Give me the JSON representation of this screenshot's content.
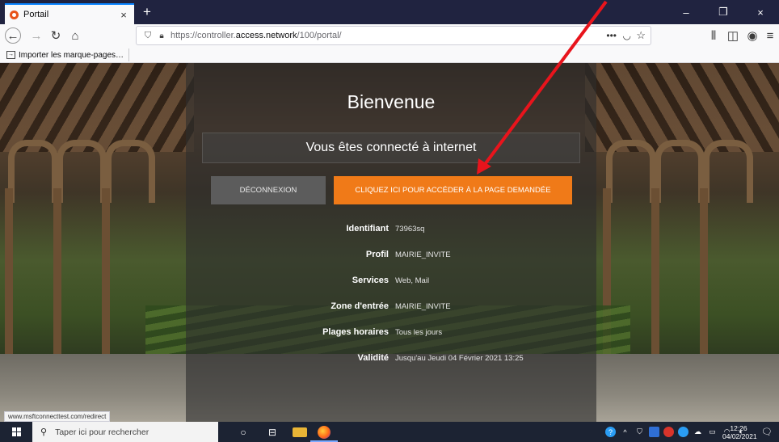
{
  "browser": {
    "tab_title": "Portail",
    "tab_close": "×",
    "new_tab": "+",
    "window_controls": {
      "minimize": "–",
      "maximize": "❐",
      "close": "×"
    },
    "url_prefix": "https://controller.",
    "url_host": "access.network",
    "url_path": "/100/portal/",
    "url_more": "•••",
    "bookmark_import": "Importer les marque-pages…",
    "status_link": "www.msftconnecttest.com/redirect"
  },
  "portal": {
    "title": "Bienvenue",
    "status": "Vous êtes connecté à internet",
    "logout_button": "Déconnexion",
    "continue_button": "CLIQUEZ ICI POUR ACCÉDER À LA PAGE DEMANDÉE",
    "info": [
      {
        "label": "Identifiant",
        "value": "73963sq"
      },
      {
        "label": "Profil",
        "value": "MAIRIE_INVITE"
      },
      {
        "label": "Services",
        "value": "Web, Mail"
      },
      {
        "label": "Zone d'entrée",
        "value": "MAIRIE_INVITE"
      },
      {
        "label": "Plages horaires",
        "value": "Tous les jours"
      },
      {
        "label": "Validité",
        "value": "Jusqu'au Jeudi 04 Février 2021 13:25"
      }
    ]
  },
  "taskbar": {
    "search_placeholder": "Taper ici pour rechercher",
    "time": "12:26",
    "date": "04/02/2021"
  },
  "colors": {
    "accent_orange": "#f07a18",
    "annotation_arrow": "#e8141c",
    "tab_highlight": "#0a84ff"
  }
}
